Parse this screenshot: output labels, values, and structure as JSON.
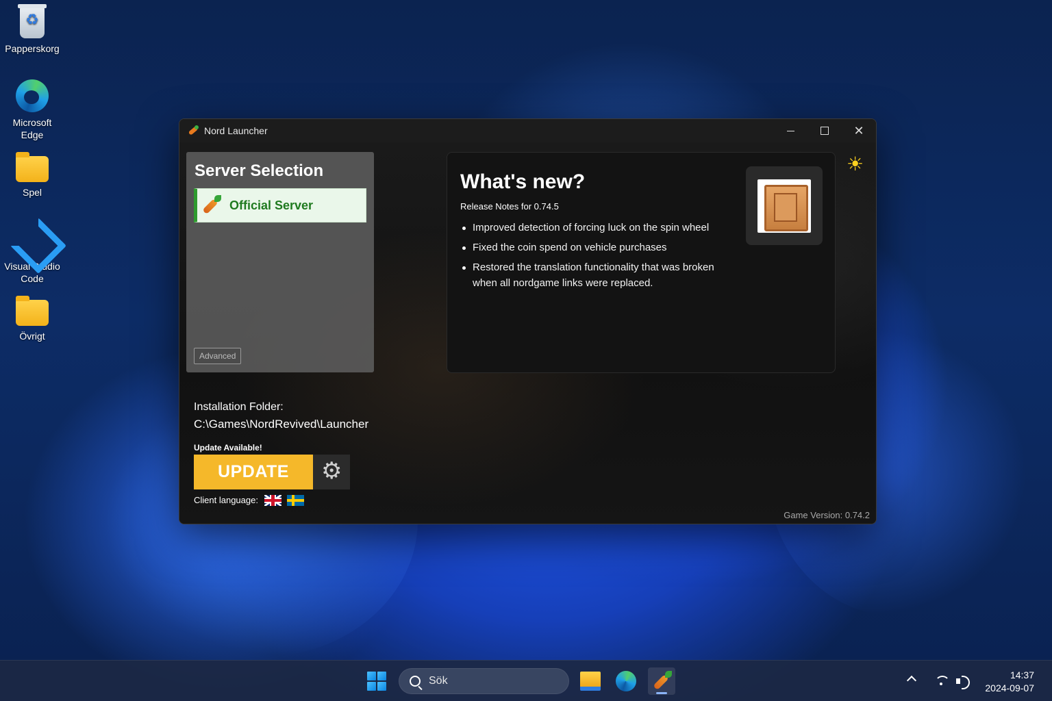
{
  "desktop": {
    "icons": [
      {
        "label": "Papperskorg",
        "icon": "recycle-bin-icon"
      },
      {
        "label": "Microsoft Edge",
        "icon": "edge-icon"
      },
      {
        "label": "Spel",
        "icon": "folder-icon"
      },
      {
        "label": "Visual Studio Code",
        "icon": "vscode-icon"
      },
      {
        "label": "Övrigt",
        "icon": "folder-icon"
      }
    ]
  },
  "window": {
    "title": "Nord Launcher",
    "server_panel": {
      "title": "Server Selection",
      "servers": [
        {
          "name": "Official Server",
          "selected": true
        }
      ],
      "advanced_label": "Advanced"
    },
    "news": {
      "title": "What's new?",
      "subtitle": "Release Notes for 0.74.5",
      "items": [
        "Improved detection of forcing luck on the spin wheel",
        "Fixed the coin spend on vehicle purchases",
        "Restored the translation functionality that was broken when all nordgame links were replaced."
      ]
    },
    "install": {
      "label": "Installation Folder:",
      "path": "C:\\Games\\NordRevived\\Launcher"
    },
    "update": {
      "status": "Update Available!",
      "button_label": "UPDATE"
    },
    "language": {
      "label": "Client language:",
      "options": [
        "uk-flag-icon",
        "sweden-flag-icon"
      ]
    },
    "game_version": "Game Version: 0.74.2"
  },
  "taskbar": {
    "search_placeholder": "Sök",
    "time": "14:37",
    "date": "2024-09-07"
  },
  "colors": {
    "accent_update": "#f5b82a",
    "server_green": "#1f7a1f",
    "window_bg": "#141414"
  }
}
